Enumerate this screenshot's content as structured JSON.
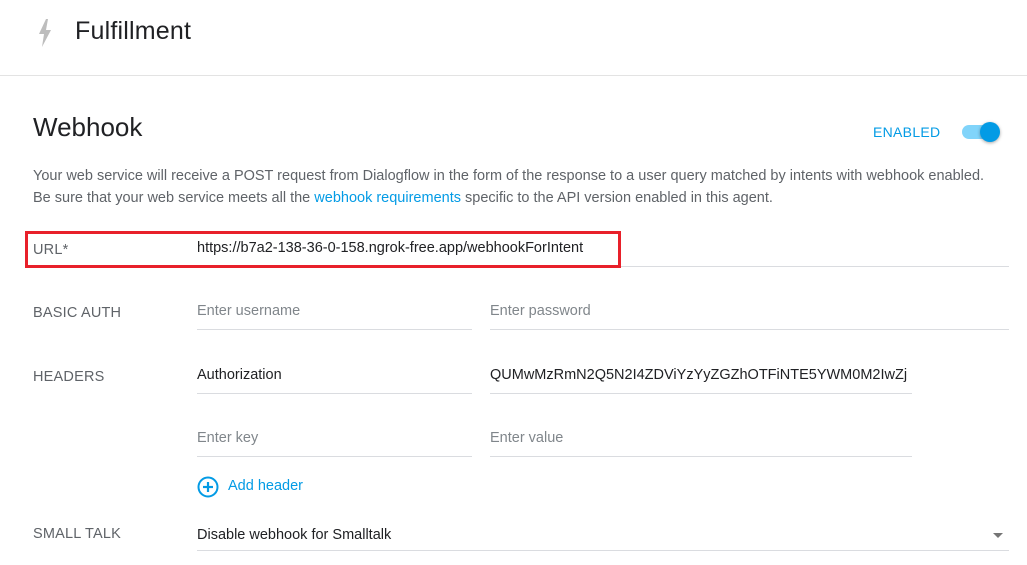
{
  "header": {
    "title": "Fulfillment",
    "icon": "bolt-icon"
  },
  "webhook": {
    "title": "Webhook",
    "enabled_label": "ENABLED",
    "enabled": true,
    "description_before": "Your web service will receive a POST request from Dialogflow in the form of the response to a user query matched by intents with webhook enabled. Be sure that your web service meets all the ",
    "description_link": "webhook requirements",
    "description_after": " specific to the API version enabled in this agent."
  },
  "url": {
    "label": "URL*",
    "value": "https://b7a2-138-36-0-158.ngrok-free.app/webhookForIntent"
  },
  "basic_auth": {
    "label": "BASIC AUTH",
    "username_placeholder": "Enter username",
    "password_placeholder": "Enter password"
  },
  "headers": {
    "label": "HEADERS",
    "rows": [
      {
        "key": "Authorization",
        "value": "QUMwMzRmN2Q5N2I4ZDViYzYyZGZhOTFiNTE5YWM0M2IwZj"
      }
    ],
    "key_placeholder": "Enter key",
    "value_placeholder": "Enter value",
    "add_label": "Add header"
  },
  "small_talk": {
    "label": "SMALL TALK",
    "selected": "Disable webhook for Smalltalk"
  },
  "colors": {
    "accent": "#039be5",
    "highlight": "#e8202a",
    "toggle_track": "#81d4fa"
  }
}
